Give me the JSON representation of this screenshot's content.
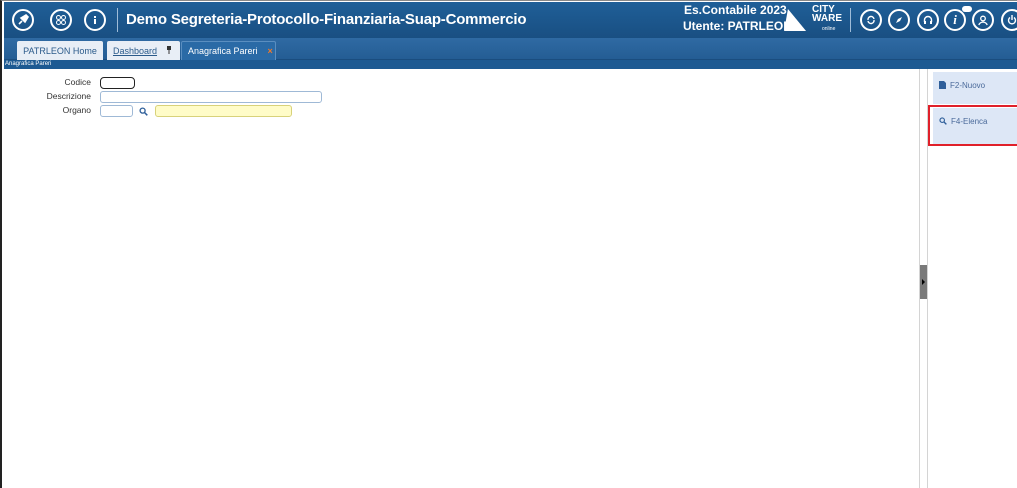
{
  "header": {
    "icons": [
      "rocket-icon",
      "grid-icon",
      "info-icon"
    ],
    "title": "Demo Segreteria-Protocollo-Finanziaria-Suap-Commercio",
    "es_contabile": "Es.Contabile 2023",
    "utente": "Utente: PATRLEON",
    "logo_text": "CITY WARE",
    "logo_sub": "online",
    "right_icons": [
      "refresh-icon",
      "compass-icon",
      "headset-icon",
      "info-italic-icon",
      "user-icon",
      "power-icon"
    ]
  },
  "tabs": [
    {
      "label": "PATRLEON Home"
    },
    {
      "label": "Dashboard"
    },
    {
      "label": "Anagrafica Pareri"
    }
  ],
  "breadcrumb": "Anagrafica Pareri",
  "form": {
    "codice_label": "Codice",
    "codice_value": "",
    "descrizione_label": "Descrizione",
    "descrizione_value": "",
    "organo_label": "Organo",
    "organo_value": "",
    "organo_desc_value": ""
  },
  "actions": {
    "nuovo_label": "F2-Nuovo",
    "elenca_label": "F4-Elenca"
  },
  "colors": {
    "header_bg": "#1f5f98",
    "highlight": "#e0202a"
  }
}
